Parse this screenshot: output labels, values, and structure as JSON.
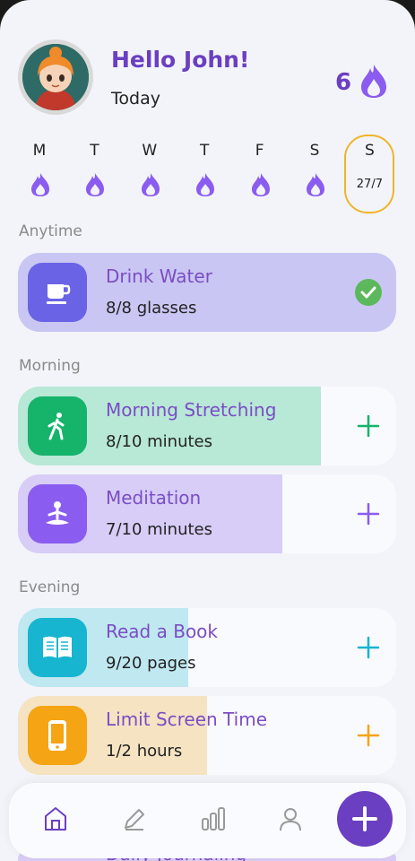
{
  "header": {
    "greeting": "Hello John!",
    "date_label": "Today",
    "streak_count": "6"
  },
  "week": [
    {
      "letter": "M",
      "date": "",
      "completed": true
    },
    {
      "letter": "T",
      "date": "",
      "completed": true
    },
    {
      "letter": "W",
      "date": "",
      "completed": true
    },
    {
      "letter": "T",
      "date": "",
      "completed": true
    },
    {
      "letter": "F",
      "date": "",
      "completed": true
    },
    {
      "letter": "S",
      "date": "",
      "completed": true
    },
    {
      "letter": "S",
      "date": "27/7",
      "completed": false,
      "is_today": true
    }
  ],
  "sections": {
    "anytime": "Anytime",
    "morning": "Morning",
    "evening": "Evening"
  },
  "habits": [
    {
      "title": "Drink Water",
      "progress": "8/8 glasses",
      "fraction": 1.0,
      "icon": "cup-icon",
      "icon_color": "#6b63e6",
      "fill_color": "#c9c6f3",
      "accent": "#5cb85c",
      "done": true
    },
    {
      "title": "Morning Stretching",
      "progress": "8/10 minutes",
      "fraction": 0.8,
      "icon": "walking-person-icon",
      "icon_color": "#16b36b",
      "fill_color": "#b8e8d6",
      "accent": "#16b36b",
      "done": false
    },
    {
      "title": "Meditation",
      "progress": "7/10 minutes",
      "fraction": 0.7,
      "icon": "meditation-icon",
      "icon_color": "#8a5cf0",
      "fill_color": "#d7cdf7",
      "accent": "#8a5cf0",
      "done": false
    },
    {
      "title": "Read a Book",
      "progress": "9/20 pages",
      "fraction": 0.45,
      "icon": "book-icon",
      "icon_color": "#17b5cf",
      "fill_color": "#bfe8f1",
      "accent": "#17b5cf",
      "done": false
    },
    {
      "title": "Limit Screen Time",
      "progress": "1/2 hours",
      "fraction": 0.5,
      "icon": "phone-icon",
      "icon_color": "#f5a414",
      "fill_color": "#f5e3c2",
      "accent": "#f5a414",
      "done": false
    }
  ],
  "peek_habit": "Daily Journaling",
  "nav": {
    "items": [
      "home-icon",
      "pencil-icon",
      "chart-icon",
      "profile-icon"
    ],
    "add": "+"
  },
  "colors": {
    "brand": "#6a3fc1",
    "today_border": "#f0b429"
  }
}
